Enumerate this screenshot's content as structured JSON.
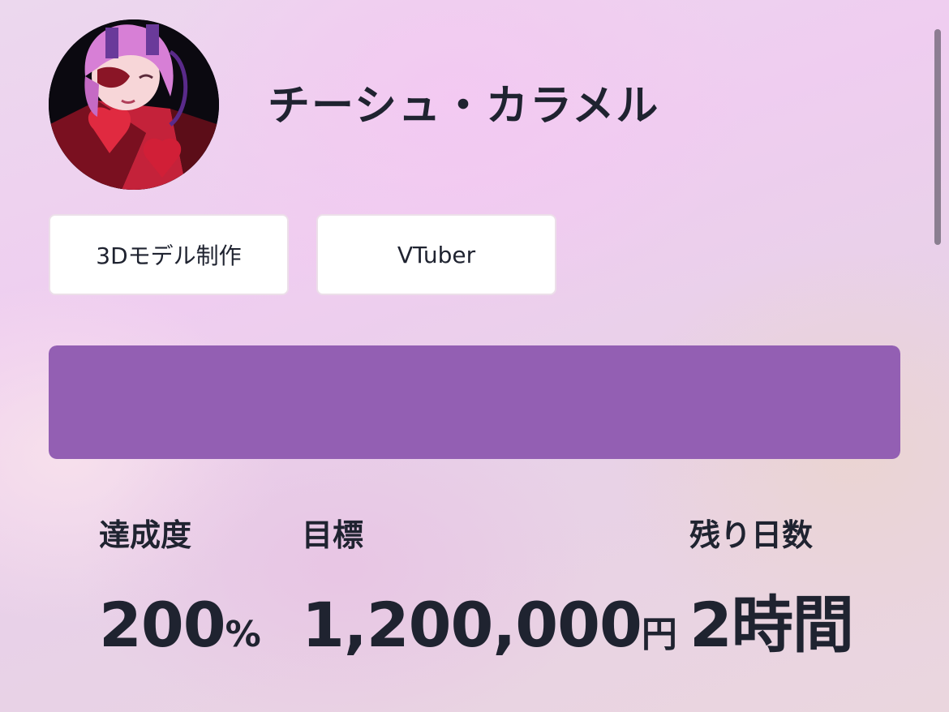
{
  "profile": {
    "name": "チーシュ・カラメル",
    "avatar": "vtuber-avatar-image"
  },
  "tags": [
    "3Dモデル制作",
    "VTuber"
  ],
  "progress": {
    "percent": 100,
    "color": "#935fb3"
  },
  "stats": {
    "achievement": {
      "label": "達成度",
      "value": "200",
      "unit": "%"
    },
    "goal": {
      "label": "目標",
      "value": "1,200,000",
      "unit": "円"
    },
    "remaining": {
      "label": "残り日数",
      "value": "2時間",
      "unit": ""
    }
  }
}
